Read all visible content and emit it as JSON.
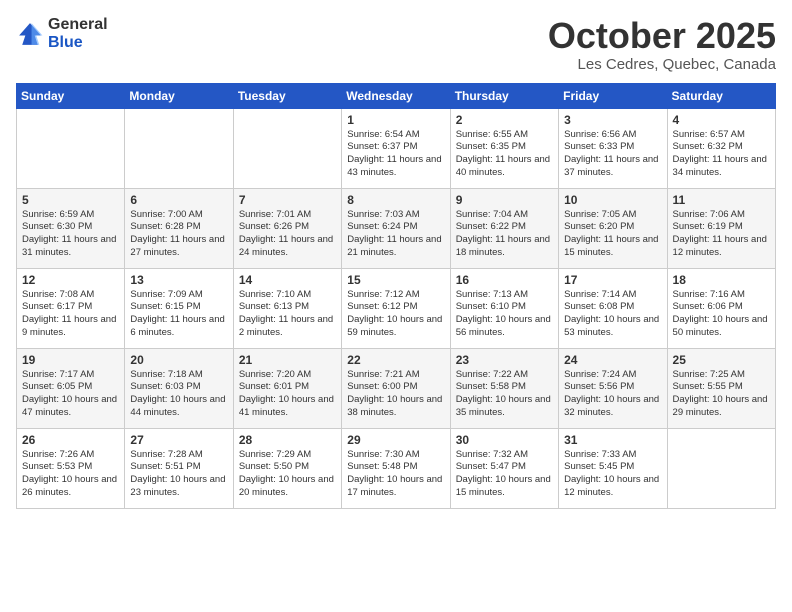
{
  "logo": {
    "general": "General",
    "blue": "Blue"
  },
  "header": {
    "month": "October 2025",
    "location": "Les Cedres, Quebec, Canada"
  },
  "weekdays": [
    "Sunday",
    "Monday",
    "Tuesday",
    "Wednesday",
    "Thursday",
    "Friday",
    "Saturday"
  ],
  "weeks": [
    [
      {
        "day": "",
        "sunrise": "",
        "sunset": "",
        "daylight": ""
      },
      {
        "day": "",
        "sunrise": "",
        "sunset": "",
        "daylight": ""
      },
      {
        "day": "",
        "sunrise": "",
        "sunset": "",
        "daylight": ""
      },
      {
        "day": "1",
        "sunrise": "Sunrise: 6:54 AM",
        "sunset": "Sunset: 6:37 PM",
        "daylight": "Daylight: 11 hours and 43 minutes."
      },
      {
        "day": "2",
        "sunrise": "Sunrise: 6:55 AM",
        "sunset": "Sunset: 6:35 PM",
        "daylight": "Daylight: 11 hours and 40 minutes."
      },
      {
        "day": "3",
        "sunrise": "Sunrise: 6:56 AM",
        "sunset": "Sunset: 6:33 PM",
        "daylight": "Daylight: 11 hours and 37 minutes."
      },
      {
        "day": "4",
        "sunrise": "Sunrise: 6:57 AM",
        "sunset": "Sunset: 6:32 PM",
        "daylight": "Daylight: 11 hours and 34 minutes."
      }
    ],
    [
      {
        "day": "5",
        "sunrise": "Sunrise: 6:59 AM",
        "sunset": "Sunset: 6:30 PM",
        "daylight": "Daylight: 11 hours and 31 minutes."
      },
      {
        "day": "6",
        "sunrise": "Sunrise: 7:00 AM",
        "sunset": "Sunset: 6:28 PM",
        "daylight": "Daylight: 11 hours and 27 minutes."
      },
      {
        "day": "7",
        "sunrise": "Sunrise: 7:01 AM",
        "sunset": "Sunset: 6:26 PM",
        "daylight": "Daylight: 11 hours and 24 minutes."
      },
      {
        "day": "8",
        "sunrise": "Sunrise: 7:03 AM",
        "sunset": "Sunset: 6:24 PM",
        "daylight": "Daylight: 11 hours and 21 minutes."
      },
      {
        "day": "9",
        "sunrise": "Sunrise: 7:04 AM",
        "sunset": "Sunset: 6:22 PM",
        "daylight": "Daylight: 11 hours and 18 minutes."
      },
      {
        "day": "10",
        "sunrise": "Sunrise: 7:05 AM",
        "sunset": "Sunset: 6:20 PM",
        "daylight": "Daylight: 11 hours and 15 minutes."
      },
      {
        "day": "11",
        "sunrise": "Sunrise: 7:06 AM",
        "sunset": "Sunset: 6:19 PM",
        "daylight": "Daylight: 11 hours and 12 minutes."
      }
    ],
    [
      {
        "day": "12",
        "sunrise": "Sunrise: 7:08 AM",
        "sunset": "Sunset: 6:17 PM",
        "daylight": "Daylight: 11 hours and 9 minutes."
      },
      {
        "day": "13",
        "sunrise": "Sunrise: 7:09 AM",
        "sunset": "Sunset: 6:15 PM",
        "daylight": "Daylight: 11 hours and 6 minutes."
      },
      {
        "day": "14",
        "sunrise": "Sunrise: 7:10 AM",
        "sunset": "Sunset: 6:13 PM",
        "daylight": "Daylight: 11 hours and 2 minutes."
      },
      {
        "day": "15",
        "sunrise": "Sunrise: 7:12 AM",
        "sunset": "Sunset: 6:12 PM",
        "daylight": "Daylight: 10 hours and 59 minutes."
      },
      {
        "day": "16",
        "sunrise": "Sunrise: 7:13 AM",
        "sunset": "Sunset: 6:10 PM",
        "daylight": "Daylight: 10 hours and 56 minutes."
      },
      {
        "day": "17",
        "sunrise": "Sunrise: 7:14 AM",
        "sunset": "Sunset: 6:08 PM",
        "daylight": "Daylight: 10 hours and 53 minutes."
      },
      {
        "day": "18",
        "sunrise": "Sunrise: 7:16 AM",
        "sunset": "Sunset: 6:06 PM",
        "daylight": "Daylight: 10 hours and 50 minutes."
      }
    ],
    [
      {
        "day": "19",
        "sunrise": "Sunrise: 7:17 AM",
        "sunset": "Sunset: 6:05 PM",
        "daylight": "Daylight: 10 hours and 47 minutes."
      },
      {
        "day": "20",
        "sunrise": "Sunrise: 7:18 AM",
        "sunset": "Sunset: 6:03 PM",
        "daylight": "Daylight: 10 hours and 44 minutes."
      },
      {
        "day": "21",
        "sunrise": "Sunrise: 7:20 AM",
        "sunset": "Sunset: 6:01 PM",
        "daylight": "Daylight: 10 hours and 41 minutes."
      },
      {
        "day": "22",
        "sunrise": "Sunrise: 7:21 AM",
        "sunset": "Sunset: 6:00 PM",
        "daylight": "Daylight: 10 hours and 38 minutes."
      },
      {
        "day": "23",
        "sunrise": "Sunrise: 7:22 AM",
        "sunset": "Sunset: 5:58 PM",
        "daylight": "Daylight: 10 hours and 35 minutes."
      },
      {
        "day": "24",
        "sunrise": "Sunrise: 7:24 AM",
        "sunset": "Sunset: 5:56 PM",
        "daylight": "Daylight: 10 hours and 32 minutes."
      },
      {
        "day": "25",
        "sunrise": "Sunrise: 7:25 AM",
        "sunset": "Sunset: 5:55 PM",
        "daylight": "Daylight: 10 hours and 29 minutes."
      }
    ],
    [
      {
        "day": "26",
        "sunrise": "Sunrise: 7:26 AM",
        "sunset": "Sunset: 5:53 PM",
        "daylight": "Daylight: 10 hours and 26 minutes."
      },
      {
        "day": "27",
        "sunrise": "Sunrise: 7:28 AM",
        "sunset": "Sunset: 5:51 PM",
        "daylight": "Daylight: 10 hours and 23 minutes."
      },
      {
        "day": "28",
        "sunrise": "Sunrise: 7:29 AM",
        "sunset": "Sunset: 5:50 PM",
        "daylight": "Daylight: 10 hours and 20 minutes."
      },
      {
        "day": "29",
        "sunrise": "Sunrise: 7:30 AM",
        "sunset": "Sunset: 5:48 PM",
        "daylight": "Daylight: 10 hours and 17 minutes."
      },
      {
        "day": "30",
        "sunrise": "Sunrise: 7:32 AM",
        "sunset": "Sunset: 5:47 PM",
        "daylight": "Daylight: 10 hours and 15 minutes."
      },
      {
        "day": "31",
        "sunrise": "Sunrise: 7:33 AM",
        "sunset": "Sunset: 5:45 PM",
        "daylight": "Daylight: 10 hours and 12 minutes."
      },
      {
        "day": "",
        "sunrise": "",
        "sunset": "",
        "daylight": ""
      }
    ]
  ]
}
